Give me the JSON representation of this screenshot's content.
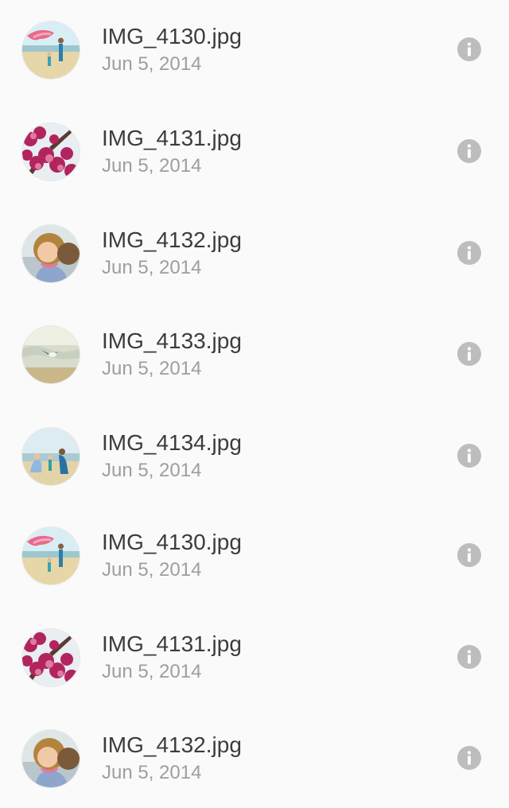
{
  "items": [
    {
      "filename": "IMG_4130.jpg",
      "date": "Jun 5, 2014",
      "thumb": "beach-kite-photo"
    },
    {
      "filename": "IMG_4131.jpg",
      "date": "Jun 5, 2014",
      "thumb": "pink-blossom-photo"
    },
    {
      "filename": "IMG_4132.jpg",
      "date": "Jun 5, 2014",
      "thumb": "child-portrait-photo"
    },
    {
      "filename": "IMG_4133.jpg",
      "date": "Jun 5, 2014",
      "thumb": "shore-bird-photo"
    },
    {
      "filename": "IMG_4134.jpg",
      "date": "Jun 5, 2014",
      "thumb": "family-beach-photo"
    },
    {
      "filename": "IMG_4130.jpg",
      "date": "Jun 5, 2014",
      "thumb": "beach-kite-photo"
    },
    {
      "filename": "IMG_4131.jpg",
      "date": "Jun 5, 2014",
      "thumb": "pink-blossom-photo"
    },
    {
      "filename": "IMG_4132.jpg",
      "date": "Jun 5, 2014",
      "thumb": "child-portrait-photo"
    }
  ],
  "info_icon": "info-icon",
  "colors": {
    "background": "#fafafa",
    "title": "#3c3c3c",
    "subtitle": "#9e9e9e",
    "info_icon": "#bdbdbd"
  }
}
